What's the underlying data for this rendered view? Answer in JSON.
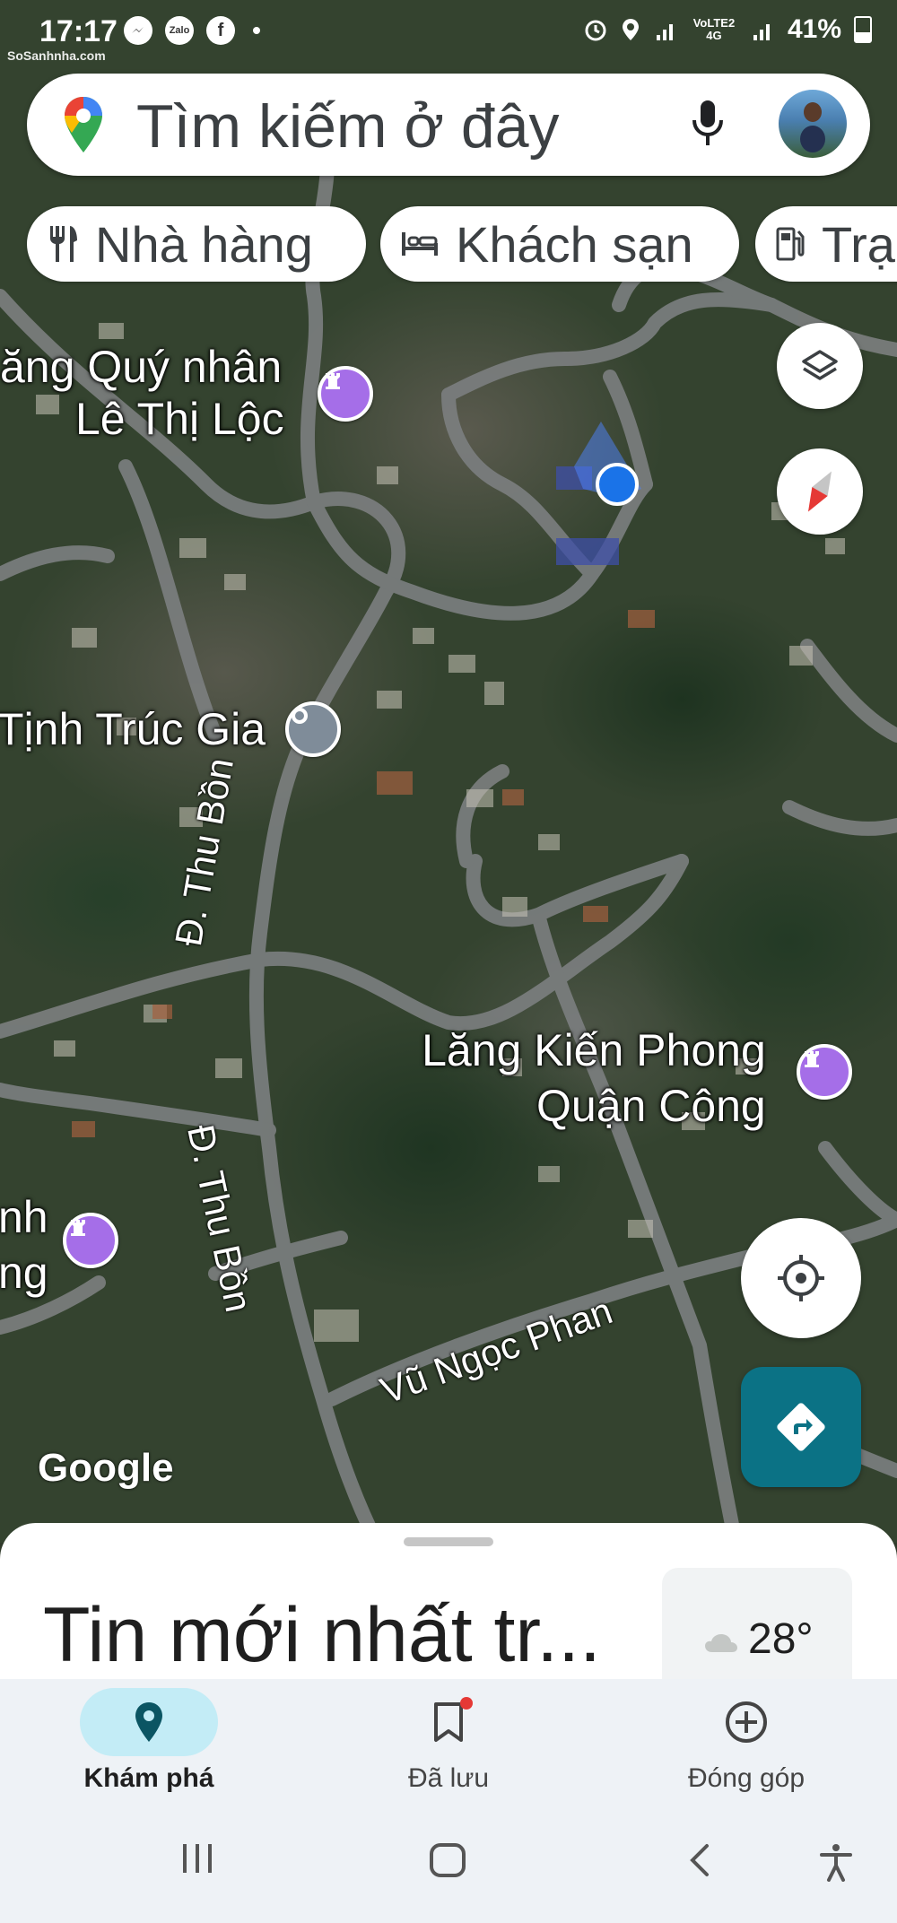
{
  "status_bar": {
    "time": "17:17",
    "network": "VoLTE2 4G",
    "battery": "41%",
    "watermark": "SoSanhnha.com",
    "left_icons": [
      "messenger-icon",
      "zalo-icon",
      "facebook-icon"
    ],
    "zalo_label": "Zalo"
  },
  "search": {
    "placeholder": "Tìm kiếm ở đây"
  },
  "chips": [
    {
      "label": "Nhà hàng",
      "icon": "restaurant-icon"
    },
    {
      "label": "Khách sạn",
      "icon": "hotel-icon"
    },
    {
      "label": "Trạ",
      "icon": "gas-station-icon"
    }
  ],
  "map": {
    "places": [
      {
        "line1": "ăng Quý nhân",
        "line2": "Lê Thị Lộc"
      },
      {
        "line1": "Tịnh Trúc Gia"
      },
      {
        "line1": "Lăng Kiến Phong",
        "line2": "Quận Công"
      },
      {
        "line1": "nh",
        "line2": "ng"
      }
    ],
    "roads": [
      "Đ. Thu Bồn",
      "Đ. Thu Bồn",
      "Vũ Ngọc Phan"
    ],
    "attribution": "Google"
  },
  "sheet": {
    "title": "Tin mới nhất tr...",
    "weather": {
      "temp": "28°",
      "icon": "cloud-icon"
    }
  },
  "nav": [
    {
      "label": "Khám phá",
      "icon": "explore-pin-icon",
      "active": true
    },
    {
      "label": "Đã lưu",
      "icon": "bookmark-icon",
      "active": false
    },
    {
      "label": "Đóng góp",
      "icon": "add-circle-icon",
      "active": false
    }
  ],
  "colors": {
    "accent_teal": "#0b7285",
    "active_pill": "#c3ecf6",
    "location_blue": "#1a73e8",
    "poi_purple": "#a56ee8"
  }
}
